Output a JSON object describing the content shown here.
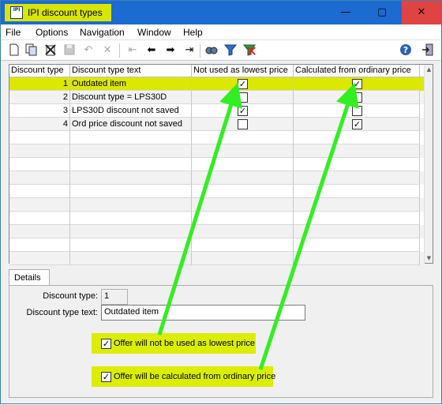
{
  "window": {
    "title": "IPI discount types",
    "app_icon_text": "IPI",
    "minimize_glyph": "—",
    "maximize_glyph": "▢",
    "close_glyph": "✕"
  },
  "menu": [
    "File",
    "Options",
    "Navigation",
    "Window",
    "Help"
  ],
  "toolbar": {
    "icons": [
      "new-icon",
      "copy-icon",
      "delete-icon",
      "save-icon",
      "undo-icon",
      "cancel-icon",
      "first-record-icon",
      "previous-record-icon",
      "next-record-icon",
      "last-record-icon",
      "find-icon",
      "filter-icon",
      "clear-filter-icon",
      "help-icon",
      "exit-icon"
    ]
  },
  "grid": {
    "columns": [
      "Discount type",
      "Discount type text",
      "Not used as lowest price",
      "Calculated from ordinary price"
    ],
    "rows": [
      {
        "type": "1",
        "text": "Outdated item",
        "not_used_lowest": true,
        "calc_ordinary": true
      },
      {
        "type": "2",
        "text": "Discount type = LPS30D",
        "not_used_lowest": false,
        "calc_ordinary": false
      },
      {
        "type": "3",
        "text": "LPS30D discount not saved",
        "not_used_lowest": true,
        "calc_ordinary": false
      },
      {
        "type": "4",
        "text": "Ord price discount not saved",
        "not_used_lowest": false,
        "calc_ordinary": true
      }
    ],
    "selected_row": 0
  },
  "details": {
    "tab_label": "Details",
    "discount_type_label": "Discount type:",
    "discount_type_value": "1",
    "discount_text_label": "Discount type text:",
    "discount_text_value": "Outdated item",
    "option1_label": "Offer will not be used as lowest price",
    "option1_checked": true,
    "option2_label": "Offer will be calculated from ordinary price",
    "option2_checked": true
  },
  "colors": {
    "highlight": "#dce800",
    "arrow": "#33ee22",
    "titlebar": "#1b6bd0",
    "close": "#e04343"
  }
}
